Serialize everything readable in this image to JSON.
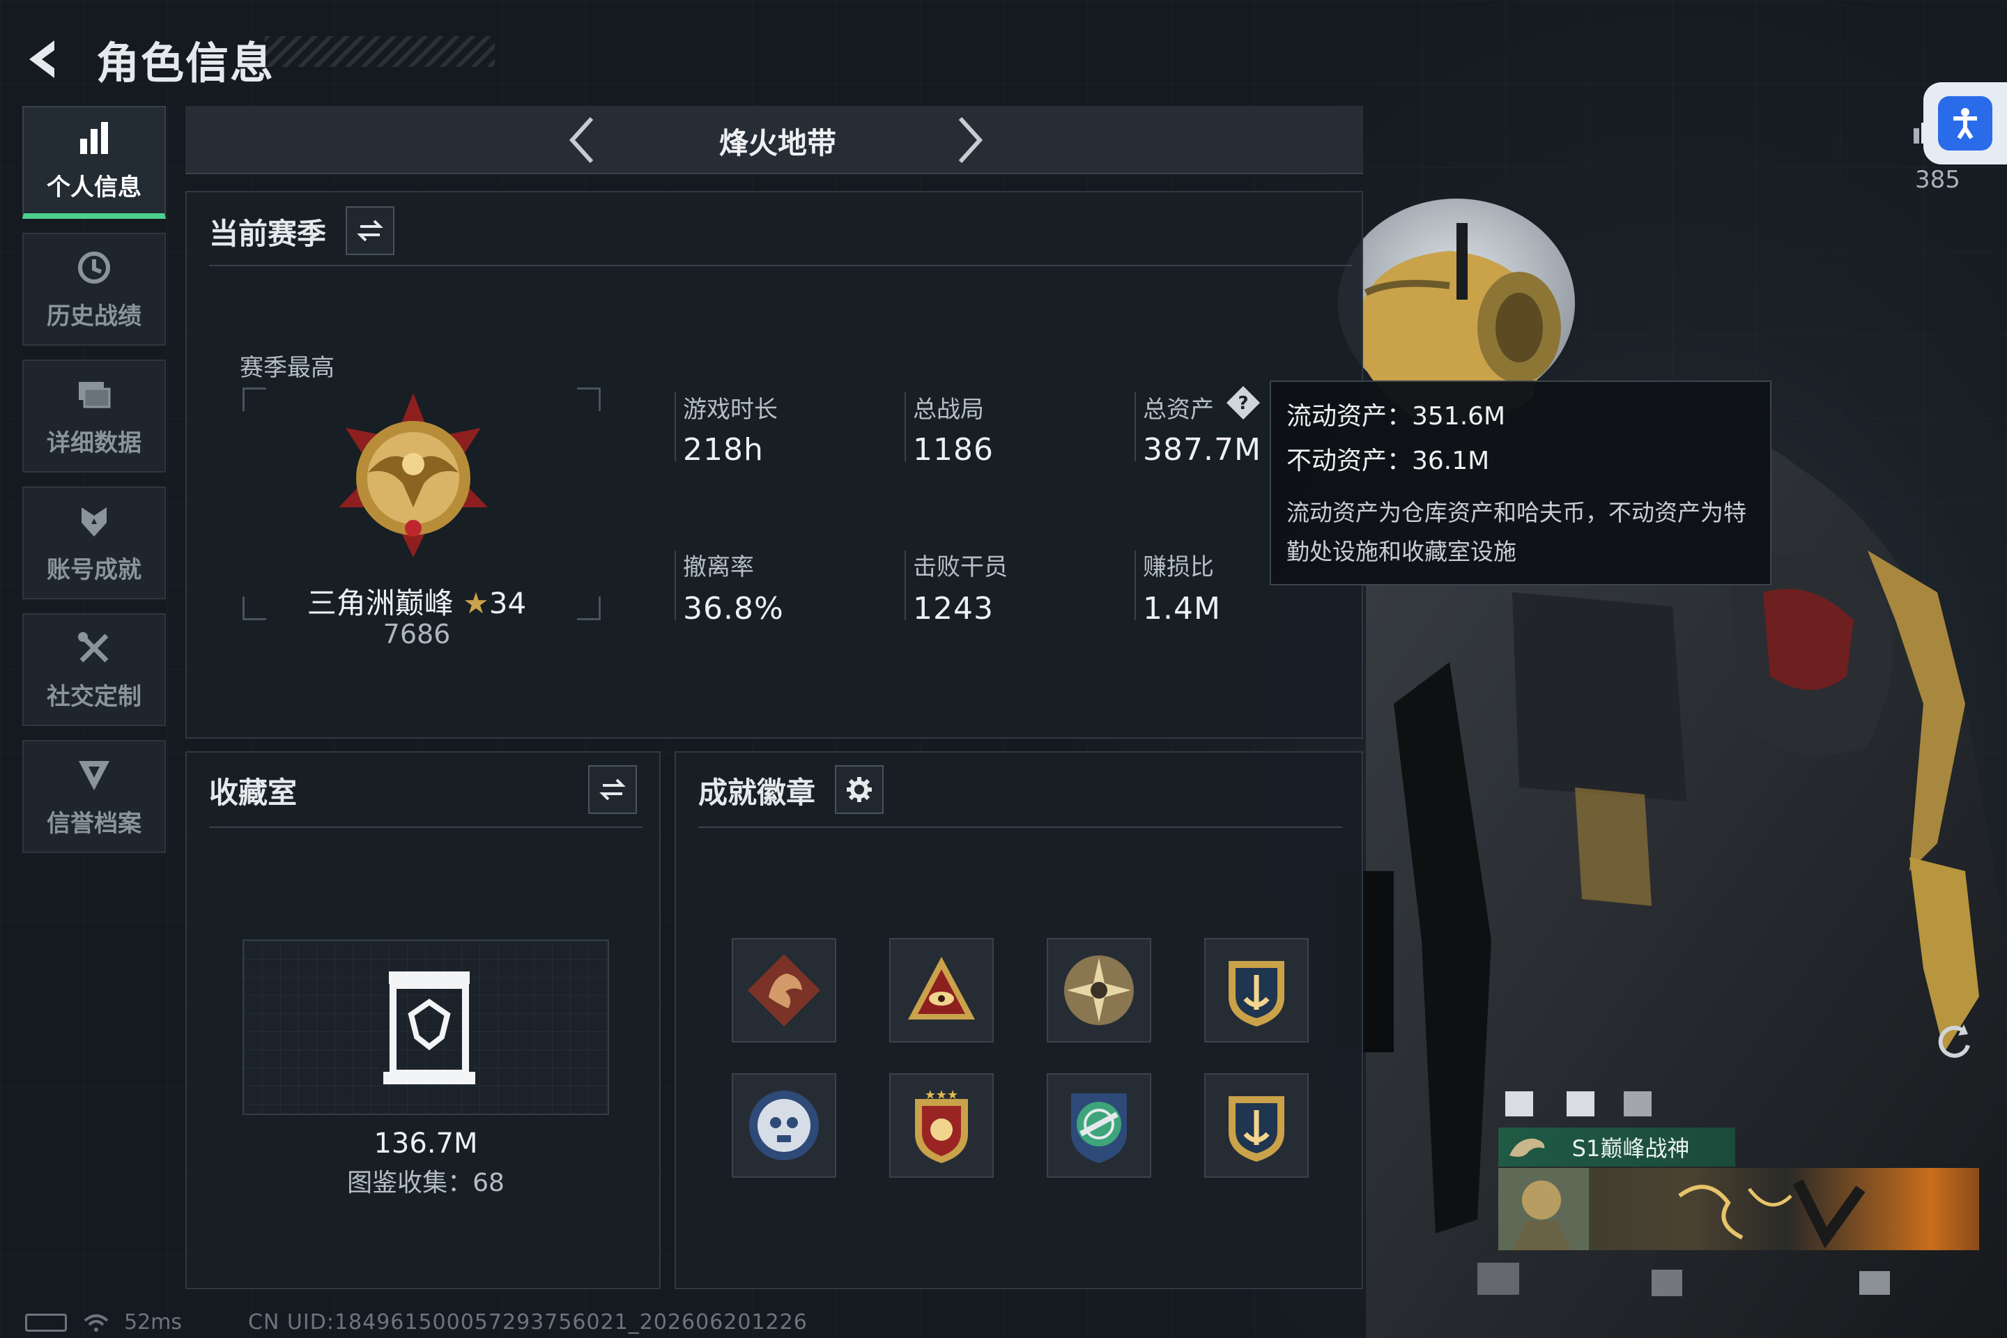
{
  "header": {
    "title": "角色信息"
  },
  "sidebar": {
    "items": [
      {
        "label": "个人信息",
        "icon": "bar-chart-icon",
        "active": true
      },
      {
        "label": "历史战绩",
        "icon": "history-clock-icon"
      },
      {
        "label": "详细数据",
        "icon": "folder-stack-icon"
      },
      {
        "label": "账号成就",
        "icon": "achievement-star-icon"
      },
      {
        "label": "社交定制",
        "icon": "tools-cross-icon"
      },
      {
        "label": "信誉档案",
        "icon": "shield-badge-icon"
      }
    ]
  },
  "mode": {
    "title": "烽火地带"
  },
  "season": {
    "title": "当前赛季",
    "best_label": "赛季最高",
    "rank_name": "三角洲巅峰",
    "rank_stars": "34",
    "rank_points": "7686",
    "stats": [
      {
        "label": "游戏时长",
        "value": "218h"
      },
      {
        "label": "总战局",
        "value": "1186"
      },
      {
        "label": "总资产",
        "value": "387.7M"
      },
      {
        "label": "撤离率",
        "value": "36.8%"
      },
      {
        "label": "击败干员",
        "value": "1243"
      },
      {
        "label": "赚损比",
        "value": "1.4M"
      }
    ]
  },
  "tooltip": {
    "liquid": "流动资产：351.6M",
    "fixed": "不动资产：36.1M",
    "desc": "流动资产为仓库资产和哈夫币，不动资产为特勤处设施和收藏室设施"
  },
  "collection": {
    "title": "收藏室",
    "value": "136.7M",
    "count": "图鉴收集：68"
  },
  "badges": {
    "title": "成就徽章",
    "items": [
      "dragon-badge-icon",
      "eye-triangle-badge-icon",
      "starburst-badge-icon",
      "anchor-gold-badge-icon",
      "skull-round-badge-icon",
      "crest-star-badge-icon",
      "rifle-shield-badge-icon",
      "anchor-gold-badge-icon"
    ]
  },
  "profile": {
    "title_tag": "S1巅峰战神",
    "top_right_value": "385"
  },
  "status": {
    "ping": "52ms",
    "uid": "CN UID:1849615000572937560​21_202606201226"
  },
  "colors": {
    "accent_green": "#4fd18e",
    "gold": "#c9a24a",
    "background": "#161c22",
    "a11y_blue": "#2a6bea"
  }
}
